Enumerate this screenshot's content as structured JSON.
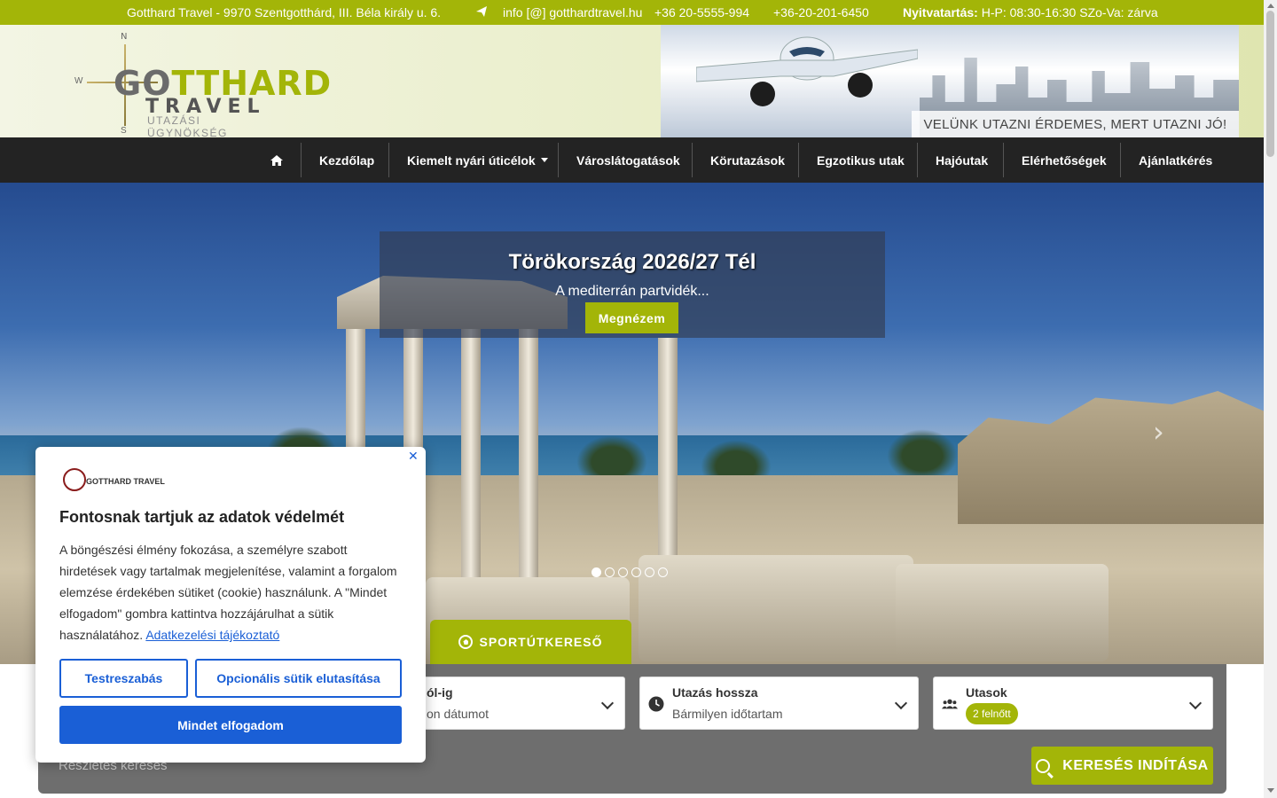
{
  "topbar": {
    "address": "Gotthard Travel - 9970 Szentgotthárd, III. Béla király u. 6.",
    "email": "info [@] gotthardtravel.hu",
    "phone1": "+36 20-5555-994",
    "phone2": "+36-20-201-6450",
    "hours_label": "Nyitvatartás:",
    "hours_value": "H-P: 08:30-16:30 SZo-Va: zárva"
  },
  "logo": {
    "compass_n": "N",
    "compass_s": "S",
    "compass_w": "W",
    "name_go": "GO",
    "name_rest": "TTHARD",
    "travel": "TRAVEL",
    "subtitle": "UTAZÁSI ÜGYNÖKSÉG"
  },
  "banner": {
    "tagline": "VELÜNK UTAZNI ÉRDEMES, MERT UTAZNI JÓ!"
  },
  "nav": {
    "home_icon": "home-icon",
    "items": [
      {
        "label": "Kezdőlap"
      },
      {
        "label": "Kiemelt nyári úticélok"
      },
      {
        "label": "Városlátogatások"
      },
      {
        "label": "Körutazások"
      },
      {
        "label": "Egzotikus utak"
      },
      {
        "label": "Hajóutak"
      },
      {
        "label": "Elérhetőségek"
      },
      {
        "label": "Ajánlatkérés"
      }
    ]
  },
  "hero": {
    "title": "Törökország 2026/27 Tél",
    "text": "A mediterrán partvidék...",
    "button": "Megnézem",
    "next": "›",
    "slide_count": 6,
    "active_slide": 1,
    "sport_tab": "SPORTÚTKERESŐ"
  },
  "search": {
    "date_label": "ól-ig",
    "date_value": "on dátumot",
    "duration_label": "Utazás hossza",
    "duration_value": "Bármilyen időtartam",
    "travellers_label": "Utasok",
    "travellers_value": "2 felnőtt",
    "detail_link": "Részletes keresés",
    "submit": "KERESÉS INDÍTÁSA"
  },
  "cookie": {
    "close": "✕",
    "logo_text": "GOTTHARD TRAVEL",
    "title": "Fontosnak tartjuk az adatok védelmét",
    "body": "A böngészési élmény fokozása, a személyre szabott hirdetések vagy tartalmak megjelenítése, valamint a forgalom elemzése érdekében sütiket (cookie) használunk. A \"Mindet elfogadom\" gombra kattintva hozzájárulhat a sütik használatához.",
    "link": "Adatkezelési tájékoztató",
    "customize": "Testreszabás",
    "reject": "Opcionális sütik elutasítása",
    "accept": "Mindet elfogadom"
  },
  "colors": {
    "accent": "#a3b508",
    "nav_bg": "#232323",
    "cookie_blue": "#1a5fd6"
  }
}
